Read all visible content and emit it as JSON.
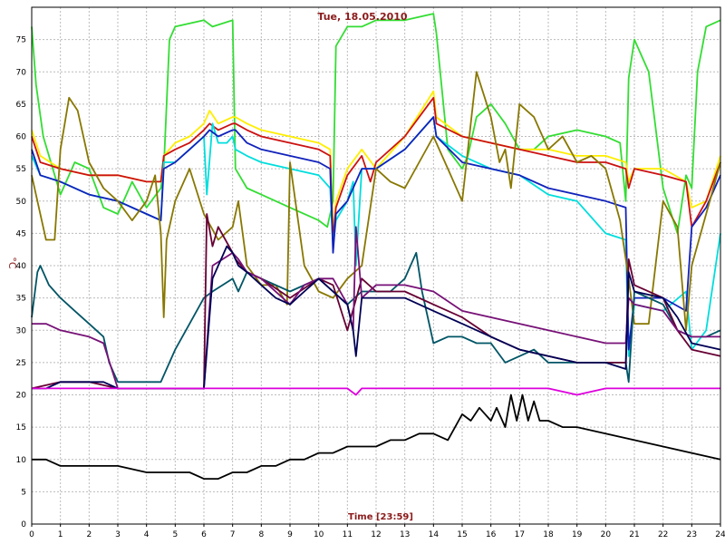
{
  "chart_data": {
    "type": "line",
    "title": "Tue, 18.05.2010",
    "xlabel": "Time [23:59]",
    "ylabel": "°C",
    "xlim": [
      0,
      24
    ],
    "ylim": [
      0,
      80
    ],
    "xticks": [
      0,
      1,
      2,
      3,
      4,
      5,
      6,
      7,
      8,
      9,
      10,
      11,
      12,
      13,
      14,
      15,
      16,
      17,
      18,
      19,
      20,
      21,
      22,
      23,
      24
    ],
    "yticks": [
      0,
      5,
      10,
      15,
      20,
      25,
      30,
      35,
      40,
      45,
      50,
      55,
      60,
      65,
      70,
      75
    ],
    "grid": true,
    "series": [
      {
        "color": "#33dd33",
        "x": [
          0,
          0.15,
          0.4,
          1,
          1.5,
          2,
          2.5,
          3,
          3.5,
          4,
          4.5,
          4.6,
          4.8,
          5,
          6,
          6.3,
          7,
          7.1,
          7.5,
          8,
          9,
          10,
          10.3,
          10.5,
          10.6,
          11,
          11.5,
          12,
          13,
          14,
          14.1,
          14.5,
          15,
          15.2,
          15.5,
          16,
          16.5,
          17,
          17.5,
          18,
          19,
          20,
          20.5,
          20.7,
          20.8,
          21,
          21.5,
          22,
          22.5,
          22.8,
          23,
          23.2,
          23.5,
          24
        ],
        "values": [
          77,
          68,
          60,
          51,
          56,
          55,
          49,
          48,
          53,
          49,
          52,
          55,
          75,
          77,
          78,
          77,
          78,
          55,
          52,
          51,
          49,
          47,
          46,
          50,
          74,
          77,
          77,
          78,
          78,
          79,
          76,
          58,
          55,
          57,
          63,
          65,
          62,
          58,
          58,
          60,
          61,
          60,
          59,
          50,
          69,
          75,
          70,
          52,
          45,
          54,
          52,
          70,
          77,
          78
        ]
      },
      {
        "color": "#ffee00",
        "x": [
          0,
          0.3,
          1,
          2,
          3,
          4,
          4.5,
          4.6,
          5,
          5.5,
          6,
          6.2,
          6.5,
          7,
          7.1,
          7.5,
          8,
          9,
          10,
          10.4,
          10.5,
          10.6,
          11,
          11.5,
          12,
          13,
          14,
          14.1,
          15,
          16,
          17,
          18,
          19,
          20,
          20.7,
          20.8,
          21,
          22,
          22.8,
          23,
          23.5,
          24
        ],
        "values": [
          61,
          57,
          55,
          54,
          54,
          53,
          53,
          57,
          59,
          60,
          62,
          64,
          62,
          63,
          63,
          62,
          61,
          60,
          59,
          58,
          45,
          50,
          55,
          58,
          55,
          60,
          67,
          63,
          60,
          59,
          58,
          58,
          57,
          57,
          56,
          53,
          55,
          55,
          53,
          49,
          50,
          57
        ]
      },
      {
        "color": "#cc1111",
        "x": [
          0,
          0.3,
          1,
          2,
          3,
          4,
          4.5,
          4.6,
          5,
          5.5,
          6,
          6.2,
          6.5,
          7,
          7.1,
          7.5,
          8,
          9,
          10,
          10.4,
          10.5,
          10.6,
          11,
          11.5,
          11.8,
          12,
          13,
          14,
          14.1,
          15,
          16,
          17,
          18,
          19,
          20,
          20.7,
          20.8,
          21,
          22,
          22.8,
          23,
          23.5,
          24
        ],
        "values": [
          60,
          56,
          55,
          54,
          54,
          53,
          53,
          57,
          58,
          59,
          61,
          62,
          61,
          62,
          62,
          61,
          60,
          59,
          58,
          57,
          44,
          49,
          54,
          57,
          53,
          56,
          60,
          66,
          62,
          60,
          59,
          58,
          57,
          56,
          56,
          55,
          52,
          55,
          54,
          53,
          46,
          50,
          56
        ]
      },
      {
        "color": "#00dddd",
        "x": [
          0,
          0.3,
          1,
          2,
          3,
          4,
          4.5,
          4.6,
          5,
          5.5,
          6,
          6.1,
          6.3,
          6.5,
          6.8,
          7,
          7.1,
          7.5,
          8,
          9,
          10,
          10.4,
          10.5,
          10.6,
          11,
          11.2,
          11.3,
          11.5,
          12,
          13,
          14,
          14.1,
          15,
          16,
          17,
          18,
          19,
          20,
          20.7,
          20.8,
          21,
          22,
          22.8,
          23,
          23.5,
          24
        ],
        "values": [
          57,
          54,
          53,
          51,
          50,
          48,
          47,
          56,
          56,
          58,
          60,
          51,
          62,
          59,
          59,
          60,
          58,
          57,
          56,
          55,
          54,
          52,
          43,
          47,
          50,
          53,
          40,
          55,
          55,
          58,
          63,
          60,
          57,
          55,
          54,
          51,
          50,
          45,
          44,
          26,
          34,
          33,
          36,
          27,
          30,
          45
        ]
      },
      {
        "color": "#1122bb",
        "x": [
          0,
          0.3,
          1,
          2,
          3,
          4,
          4.5,
          4.6,
          5,
          5.5,
          6,
          6.2,
          6.5,
          7,
          7.1,
          7.5,
          8,
          9,
          10,
          10.4,
          10.5,
          10.6,
          11,
          11.5,
          12,
          13,
          14,
          14.1,
          15,
          16,
          17,
          18,
          19,
          20,
          20.7,
          20.8,
          21,
          22,
          22.8,
          23,
          23.5,
          24
        ],
        "values": [
          58,
          54,
          53,
          51,
          50,
          48,
          47,
          55,
          56,
          58,
          60,
          61,
          60,
          61,
          61,
          59,
          58,
          57,
          56,
          55,
          42,
          48,
          50,
          55,
          55,
          58,
          63,
          60,
          56,
          55,
          54,
          52,
          51,
          50,
          49,
          27,
          35,
          35,
          33,
          46,
          49,
          54
        ]
      },
      {
        "color": "#887700",
        "x": [
          0,
          0.2,
          0.5,
          0.8,
          1,
          1.3,
          1.6,
          2,
          2.5,
          3,
          3.5,
          4,
          4.3,
          4.5,
          4.6,
          4.7,
          5,
          5.5,
          6,
          6.5,
          7,
          7.2,
          7.5,
          8,
          8.5,
          8.9,
          9,
          9.5,
          10,
          10.5,
          11,
          11.5,
          12,
          12.5,
          13,
          13.5,
          14,
          14.5,
          15,
          15.5,
          16,
          16.3,
          16.5,
          16.7,
          17,
          17.5,
          18,
          18.5,
          19,
          19.5,
          20,
          20.5,
          20.8,
          21,
          21.5,
          22,
          22.5,
          22.8,
          23,
          23.5,
          24
        ],
        "values": [
          54,
          50,
          44,
          44,
          58,
          66,
          64,
          56,
          52,
          50,
          47,
          50,
          54,
          45,
          32,
          44,
          50,
          55,
          48,
          44,
          46,
          50,
          40,
          37,
          37,
          34,
          56,
          40,
          36,
          35,
          38,
          40,
          55,
          53,
          52,
          56,
          60,
          55,
          50,
          70,
          63,
          56,
          58,
          52,
          65,
          63,
          58,
          60,
          56,
          57,
          55,
          47,
          38,
          31,
          31,
          50,
          46,
          30,
          40,
          48,
          56
        ]
      },
      {
        "color": "#005566",
        "x": [
          0,
          0.2,
          0.3,
          0.6,
          1,
          1.5,
          2,
          2.5,
          2.7,
          3,
          4,
          4.5,
          5,
          5.5,
          6,
          6.3,
          7,
          7.2,
          7.5,
          8,
          9,
          10,
          10.5,
          11,
          11.5,
          12,
          12.5,
          13,
          13.4,
          13.6,
          14,
          14.5,
          15,
          15.5,
          16,
          16.5,
          17,
          17.5,
          18,
          19,
          20,
          20.7,
          20.8,
          21,
          22,
          22.5,
          23,
          23.5,
          24
        ],
        "values": [
          32,
          39,
          40,
          37,
          35,
          33,
          31,
          29,
          25,
          22,
          22,
          22,
          27,
          31,
          35,
          36,
          38,
          36,
          39,
          38,
          36,
          38,
          36,
          34,
          36,
          36,
          36,
          38,
          42,
          36,
          28,
          29,
          29,
          28,
          28,
          25,
          26,
          27,
          25,
          25,
          25,
          25,
          22,
          36,
          34,
          30,
          29,
          29,
          30
        ]
      },
      {
        "color": "#660033",
        "x": [
          0,
          1,
          2,
          3,
          4,
          5,
          6,
          6.1,
          6.3,
          6.5,
          7,
          7.1,
          7.5,
          8,
          9,
          10,
          10.5,
          11,
          11.5,
          12,
          13,
          14,
          15,
          16,
          17,
          18,
          19,
          20,
          20.7,
          20.8,
          21,
          22,
          22.5,
          23,
          24
        ],
        "values": [
          21,
          22,
          22,
          21,
          21,
          21,
          21,
          48,
          43,
          46,
          42,
          41,
          39,
          38,
          35,
          38,
          37,
          30,
          38,
          36,
          36,
          34,
          32,
          29,
          27,
          26,
          25,
          25,
          25,
          41,
          37,
          35,
          30,
          27,
          26
        ]
      },
      {
        "color": "#771177",
        "x": [
          0,
          0.5,
          1,
          2,
          2.5,
          3,
          4,
          5,
          6,
          6.3,
          7,
          7.2,
          7.5,
          8,
          9,
          9.5,
          10,
          10.5,
          11,
          11.2,
          11.3,
          11.5,
          12,
          13,
          14,
          15,
          16,
          17,
          18,
          19,
          20,
          20.7,
          20.8,
          21,
          22,
          22.5,
          23,
          24
        ],
        "values": [
          31,
          31,
          30,
          29,
          28,
          21,
          21,
          21,
          21,
          40,
          42,
          41,
          39,
          38,
          34,
          37,
          38,
          38,
          34,
          30,
          46,
          35,
          37,
          37,
          36,
          33,
          32,
          31,
          30,
          29,
          28,
          28,
          35,
          34,
          33,
          30,
          29,
          29
        ]
      },
      {
        "color": "#000055",
        "x": [
          0,
          0.5,
          1,
          2,
          2.5,
          3,
          4,
          5,
          6,
          6.3,
          6.8,
          7,
          7.2,
          7.5,
          8,
          8.5,
          9,
          9.5,
          10,
          10.5,
          11,
          11.2,
          11.3,
          11.5,
          12,
          13,
          14,
          15,
          16,
          17,
          18,
          19,
          20,
          20.7,
          20.8,
          21,
          22,
          22.5,
          23,
          24
        ],
        "values": [
          21,
          21,
          22,
          22,
          22,
          21,
          21,
          21,
          21,
          38,
          43,
          42,
          40,
          39,
          37,
          35,
          34,
          36,
          38,
          36,
          34,
          30,
          26,
          35,
          35,
          35,
          33,
          31,
          29,
          27,
          26,
          25,
          25,
          24,
          39,
          36,
          35,
          32,
          28,
          27
        ]
      },
      {
        "color": "#dd00dd",
        "x": [
          0,
          1,
          2,
          3,
          4,
          5,
          6,
          7,
          8,
          9,
          10,
          11,
          11.3,
          11.5,
          12,
          13,
          14,
          15,
          16,
          17,
          18,
          19,
          20,
          21,
          22,
          23,
          24
        ],
        "values": [
          21,
          21,
          21,
          21,
          21,
          21,
          21,
          21,
          21,
          21,
          21,
          21,
          20,
          21,
          21,
          21,
          21,
          21,
          21,
          21,
          21,
          20,
          21,
          21,
          21,
          21,
          21
        ]
      },
      {
        "color": "#000000",
        "x": [
          0,
          0.5,
          1,
          2,
          3,
          4,
          5,
          5.5,
          6,
          6.5,
          7,
          7.5,
          8,
          8.5,
          9,
          9.5,
          10,
          10.5,
          11,
          11.5,
          12,
          12.5,
          13,
          13.5,
          14,
          14.5,
          15,
          15.3,
          15.6,
          16,
          16.2,
          16.5,
          16.7,
          16.9,
          17.1,
          17.3,
          17.5,
          17.7,
          18,
          18.5,
          19,
          20,
          21,
          22,
          23,
          24
        ],
        "values": [
          10,
          10,
          9,
          9,
          9,
          8,
          8,
          8,
          7,
          7,
          8,
          8,
          9,
          9,
          10,
          10,
          11,
          11,
          12,
          12,
          12,
          13,
          13,
          14,
          14,
          13,
          17,
          16,
          18,
          16,
          18,
          15,
          20,
          16,
          20,
          16,
          19,
          16,
          16,
          15,
          15,
          14,
          13,
          12,
          11,
          10
        ]
      }
    ]
  }
}
